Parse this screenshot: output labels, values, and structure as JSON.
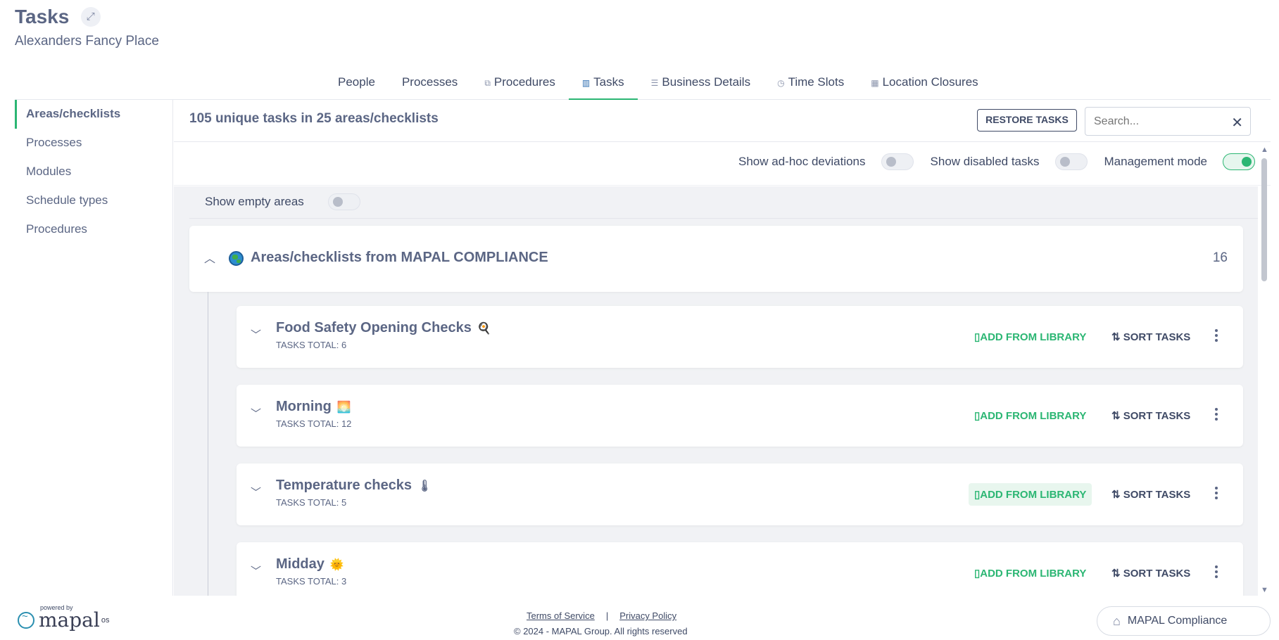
{
  "header": {
    "title": "Tasks",
    "expand_icon": "⤢",
    "subtitle": "Alexanders Fancy Place"
  },
  "tabs": [
    {
      "label": "People",
      "icon": ""
    },
    {
      "label": "Processes",
      "icon": ""
    },
    {
      "label": "Procedures",
      "icon": "procedures-icon"
    },
    {
      "label": "Tasks",
      "icon": "book-icon"
    },
    {
      "label": "Business Details",
      "icon": "list-icon"
    },
    {
      "label": "Time Slots",
      "icon": "clock-icon"
    },
    {
      "label": "Location Closures",
      "icon": "calendar-icon"
    }
  ],
  "sidebar": {
    "items": [
      {
        "label": "Areas/checklists"
      },
      {
        "label": "Processes"
      },
      {
        "label": "Modules"
      },
      {
        "label": "Schedule types"
      },
      {
        "label": "Procedures"
      }
    ]
  },
  "main": {
    "summary": "105 unique tasks in 25 areas/checklists",
    "restore_label": "RESTORE TASKS",
    "search_placeholder": "Search...",
    "toggles": {
      "adhoc_label": "Show ad-hoc deviations",
      "disabled_label": "Show disabled tasks",
      "management_label": "Management mode",
      "empty_label": "Show empty areas"
    },
    "group": {
      "title": "Areas/checklists from MAPAL COMPLIANCE",
      "count": "16"
    },
    "action_add": "ADD FROM LIBRARY",
    "action_sort": "SORT TASKS",
    "areas": [
      {
        "name": "Food Safety Opening Checks",
        "emoji": "🍳",
        "total": "TASKS TOTAL: 6"
      },
      {
        "name": "Morning",
        "emoji": "🌅",
        "total": "TASKS TOTAL: 12"
      },
      {
        "name": "Temperature checks",
        "emoji": "🌡",
        "total": "TASKS TOTAL: 5"
      },
      {
        "name": "Midday",
        "emoji": "🌞",
        "total": "TASKS TOTAL: 3"
      }
    ]
  },
  "footer": {
    "powered_by": "powered by",
    "brand": "mapal",
    "brand_sup": "os",
    "terms": "Terms of Service",
    "separator": "|",
    "privacy": "Privacy Policy",
    "copyright": "© 2024 - MAPAL Group. All rights reserved",
    "compliance_button": "MAPAL Compliance"
  },
  "colors": {
    "accent": "#2bb673",
    "text": "#5b6684",
    "background": "#f1f2f5"
  }
}
